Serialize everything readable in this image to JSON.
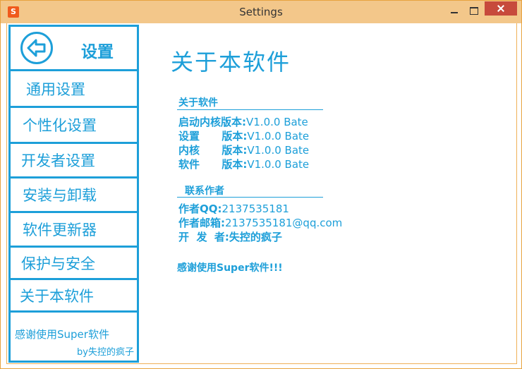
{
  "window": {
    "title": "Settings",
    "app_icon": "app-logo-icon"
  },
  "sidebar": {
    "header_title": "设置",
    "items": [
      {
        "label": "通用设置"
      },
      {
        "label": "个性化设置"
      },
      {
        "label": "开发者设置"
      },
      {
        "label": "安装与卸载"
      },
      {
        "label": "软件更新器"
      },
      {
        "label": "保护与安全"
      },
      {
        "label": "关于本软件"
      }
    ],
    "footer_thanks": "感谢使用Super软件",
    "footer_by": "by失控的疯子"
  },
  "content": {
    "title": "关于本软件",
    "about_heading": "关于软件",
    "versions": [
      {
        "label": "启动内核版本:",
        "value": "V1.0.0 Bate"
      },
      {
        "label": "设置      版本:",
        "value": "V1.0.0 Bate"
      },
      {
        "label": "内核      版本:",
        "value": "V1.0.0 Bate"
      },
      {
        "label": "软件      版本:",
        "value": "V1.0.0 Bate"
      }
    ],
    "contact_heading": "联系作者",
    "contacts": [
      {
        "label": "作者QQ:",
        "value": "2137535181"
      },
      {
        "label": "作者邮箱:",
        "value": "2137535181@qq.com"
      },
      {
        "label": "开  发  者:",
        "value": "失控的疯子"
      }
    ],
    "thanks": "感谢使用Super软件!!!"
  },
  "colors": {
    "accent": "#1d9fd9",
    "titlebar": "#f3c78a",
    "close": "#c74a3c"
  }
}
